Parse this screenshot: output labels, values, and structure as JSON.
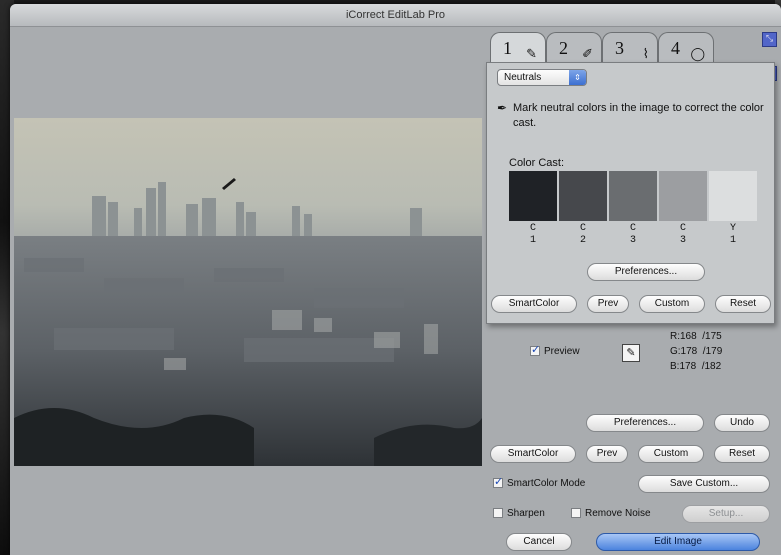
{
  "window": {
    "title": "iCorrect EditLab Pro"
  },
  "tabs": [
    {
      "label": "1",
      "icon": "eyedropper-icon"
    },
    {
      "label": "2",
      "icon": "pencil-icon"
    },
    {
      "label": "3",
      "icon": "brush-icon"
    },
    {
      "label": "4",
      "icon": "color-wheel-icon"
    }
  ],
  "panel": {
    "mode_select": {
      "value": "Neutrals"
    },
    "instructions": "Mark neutral colors in the image to correct the color cast.",
    "color_cast_label": "Color Cast:",
    "swatches": [
      {
        "color": "#1f2226",
        "label_line1": "C",
        "label_line2": "1"
      },
      {
        "color": "#46484c",
        "label_line1": "C",
        "label_line2": "2"
      },
      {
        "color": "#6a6d70",
        "label_line1": "C",
        "label_line2": "3"
      },
      {
        "color": "#9c9ea1",
        "label_line1": "C",
        "label_line2": "3"
      },
      {
        "color": "#dcdedf",
        "label_line1": "Y",
        "label_line2": "1"
      }
    ],
    "preferences_label": "Preferences...",
    "smartcolor_label": "SmartColor",
    "prev_label": "Prev",
    "custom_label": "Custom",
    "reset_label": "Reset"
  },
  "preview": {
    "label": "Preview",
    "checked": true,
    "rgb": {
      "r": "R:168  /175",
      "g": "G:178  /179",
      "b": "B:178  /182"
    }
  },
  "main": {
    "preferences_label": "Preferences...",
    "undo_label": "Undo",
    "smartcolor_label": "SmartColor",
    "prev_label": "Prev",
    "custom_label": "Custom",
    "reset_label": "Reset",
    "smartcolor_mode_label": "SmartColor Mode",
    "smartcolor_mode_checked": true,
    "save_custom_label": "Save Custom...",
    "sharpen_label": "Sharpen",
    "remove_noise_label": "Remove Noise",
    "setup_label": "Setup...",
    "cancel_label": "Cancel",
    "edit_image_label": "Edit Image"
  }
}
